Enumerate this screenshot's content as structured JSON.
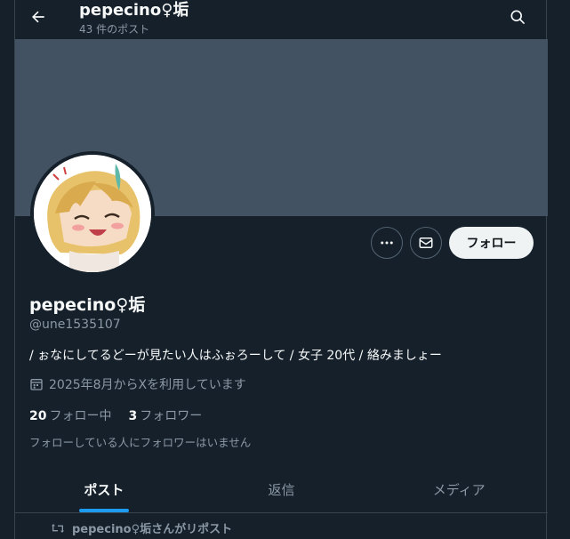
{
  "header": {
    "title": "pepecino♀垢",
    "post_count": "43 件のポスト"
  },
  "profile": {
    "display_name": "pepecino♀垢",
    "handle": "@une1535107",
    "bio": "/ ぉなにしてるどーが見たい人はふぉろーして / 女子 20代  / 絡みましょー",
    "joined": "2025年8月からXを利用しています",
    "following_count": "20",
    "following_label": "フォロー中",
    "followers_count": "3",
    "followers_label": "フォロワー",
    "followed_by_note": "フォローしている人にフォロワーはいません"
  },
  "actions": {
    "follow_label": "フォロー"
  },
  "tabs": [
    {
      "label": "ポスト",
      "active": true
    },
    {
      "label": "返信",
      "active": false
    },
    {
      "label": "メディア",
      "active": false
    }
  ],
  "repost": {
    "text": "pepecino♀垢さんがリポスト"
  },
  "colors": {
    "background": "#15202b",
    "banner": "#425262",
    "accent": "#1d9bf0",
    "secondary_text": "#8b98a5",
    "emoji_badge": "#f4475f"
  },
  "icons": [
    "back-arrow-icon",
    "search-icon",
    "more-icon",
    "mail-icon",
    "calendar-icon",
    "repost-icon"
  ]
}
